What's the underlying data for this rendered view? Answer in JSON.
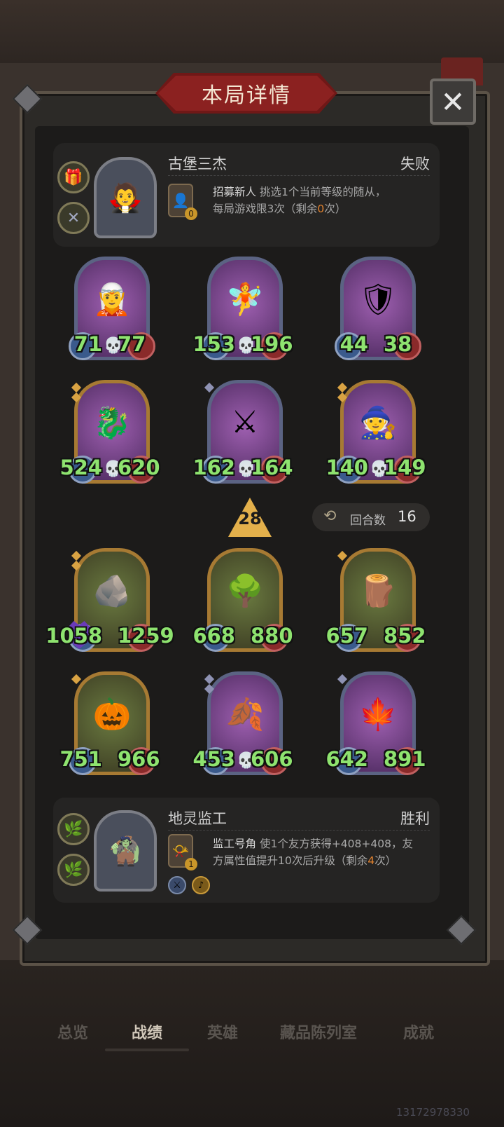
{
  "title": "本局详情",
  "close_label": "✕",
  "opponent": {
    "name": "古堡三杰",
    "result": "失败",
    "skill_name": "招募新人",
    "skill_desc_line1": "挑选1个当前等级的随从，",
    "skill_desc_line2_pre": "每局游戏限3次（剩余",
    "skill_desc_highlight": "0",
    "skill_desc_line2_post": "次）",
    "skill_cost": "0"
  },
  "opponent_minions": [
    {
      "attack": "71",
      "health": "77"
    },
    {
      "attack": "153",
      "health": "196"
    },
    {
      "attack": "44",
      "health": "38"
    },
    {
      "attack": "524",
      "health": "620"
    },
    {
      "attack": "162",
      "health": "164"
    },
    {
      "attack": "140",
      "health": "149"
    }
  ],
  "tavern_tier": "28",
  "rounds": {
    "label": "回合数",
    "value": "16"
  },
  "player_minions": [
    {
      "attack": "1058",
      "health": "1259"
    },
    {
      "attack": "668",
      "health": "880"
    },
    {
      "attack": "657",
      "health": "852"
    },
    {
      "attack": "751",
      "health": "966"
    },
    {
      "attack": "453",
      "health": "606"
    },
    {
      "attack": "642",
      "health": "891"
    }
  ],
  "player": {
    "name": "地灵监工",
    "result": "胜利",
    "skill_name": "监工号角",
    "skill_desc_line1": "使1个友方获得+408+408，友",
    "skill_desc_line2_pre": "方属性值提升10次后升级（剩余",
    "skill_desc_highlight": "4",
    "skill_desc_line2_post": "次）",
    "skill_cost": "1"
  },
  "tabs": [
    "总览",
    "战绩",
    "英雄",
    "藏品陈列室",
    "成就"
  ],
  "watermark": "13172978330",
  "icons": {
    "close": "close-icon",
    "rounds": "cycle-arrows-icon",
    "skull": "skull-icon"
  },
  "colors": {
    "stat_text": "#8ee36f",
    "banner": "#8b2120",
    "highlight": "#e0812e"
  }
}
